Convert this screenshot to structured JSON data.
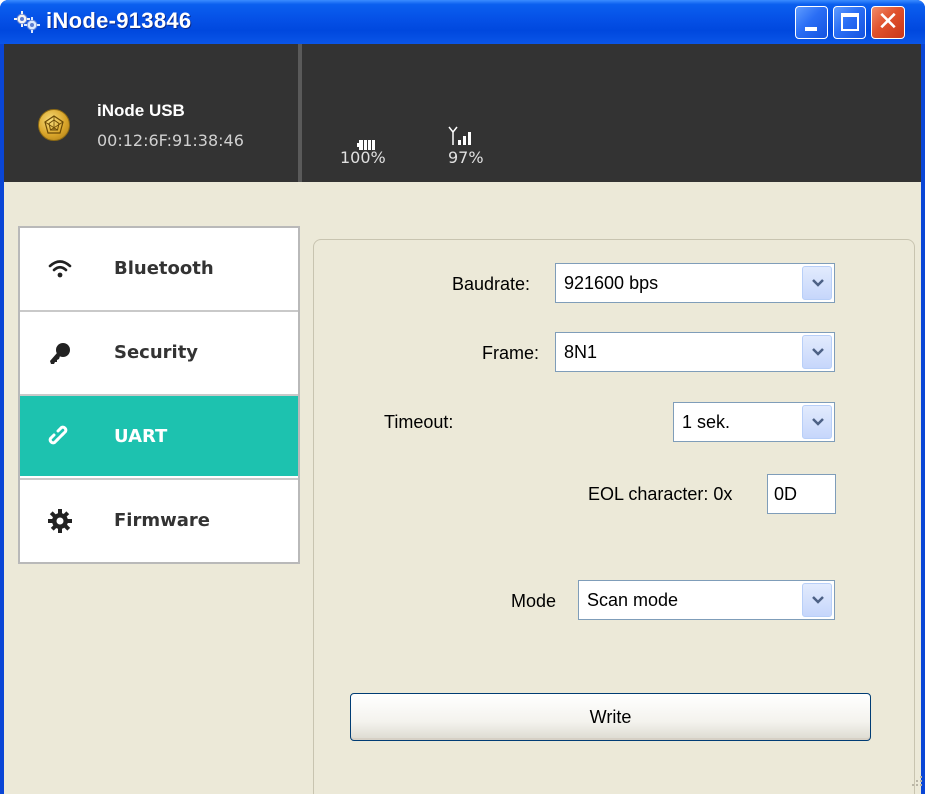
{
  "window": {
    "title": "iNode-913846",
    "icon": "gears-icon",
    "controls": {
      "minimize": "minimize-icon",
      "maximize": "maximize-icon",
      "close": "close-icon"
    }
  },
  "header": {
    "device_name": "iNode USB",
    "device_mac": "00:12:6F:91:38:46",
    "battery": "100%",
    "signal": "97%"
  },
  "sidebar": {
    "items": [
      {
        "label": "Bluetooth",
        "icon": "wifi-icon",
        "active": false
      },
      {
        "label": "Security",
        "icon": "key-icon",
        "active": false
      },
      {
        "label": "UART",
        "icon": "link-icon",
        "active": true
      },
      {
        "label": "Firmware",
        "icon": "gear-icon",
        "active": false
      }
    ],
    "active_color": "#1dc2af"
  },
  "uart": {
    "baudrate_label": "Baudrate:",
    "baudrate_value": "921600 bps",
    "frame_label": "Frame:",
    "frame_value": "8N1",
    "timeout_label": "Timeout:",
    "timeout_value": "1 sek.",
    "eol_label": "EOL character: 0x",
    "eol_value": "0D",
    "mode_label": "Mode",
    "mode_value": "Scan mode",
    "write_label": "Write"
  }
}
